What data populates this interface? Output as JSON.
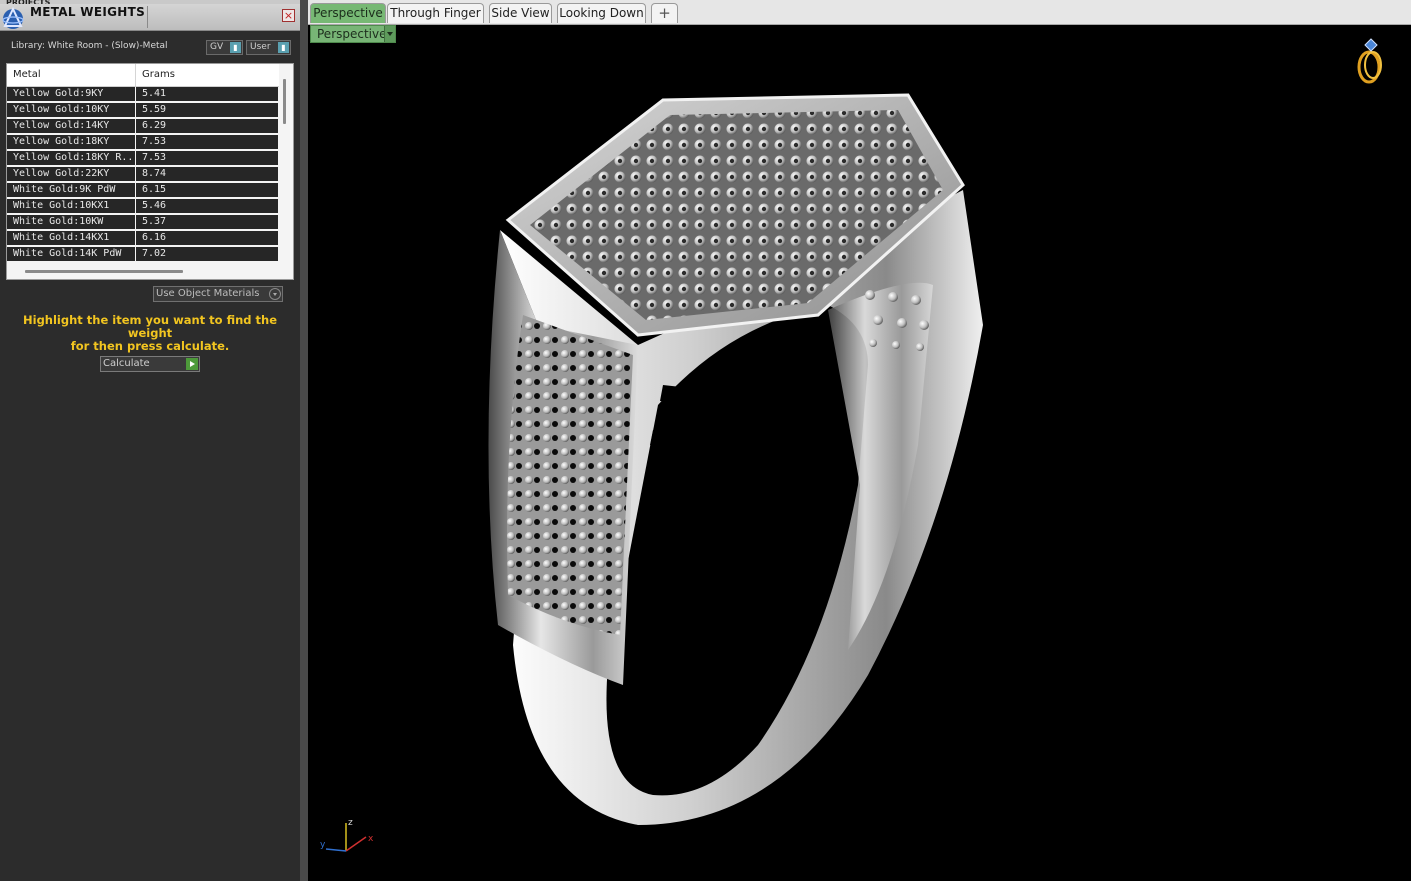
{
  "panel": {
    "header_strip": "PROJECTS",
    "title": "METAL WEIGHTS",
    "close_glyph": "×",
    "library_label": "Library: White Room - (Slow)-Metal",
    "gv_combo": "GV",
    "user_combo": "User",
    "table": {
      "columns": [
        "Metal",
        "Grams"
      ],
      "rows": [
        {
          "metal": "Yellow Gold:9KY",
          "grams": "5.41"
        },
        {
          "metal": "Yellow Gold:10KY",
          "grams": "5.59"
        },
        {
          "metal": "Yellow Gold:14KY",
          "grams": "6.29"
        },
        {
          "metal": "Yellow Gold:18KY",
          "grams": "7.53"
        },
        {
          "metal": "Yellow Gold:18KY R...",
          "grams": "7.53"
        },
        {
          "metal": "Yellow Gold:22KY",
          "grams": "8.74"
        },
        {
          "metal": "White Gold:9K PdW",
          "grams": "6.15"
        },
        {
          "metal": "White Gold:10KX1",
          "grams": "5.46"
        },
        {
          "metal": "White Gold:10KW",
          "grams": "5.37"
        },
        {
          "metal": "White Gold:14KX1",
          "grams": "6.16"
        },
        {
          "metal": "White Gold:14K PdW",
          "grams": "7.02"
        }
      ]
    },
    "materials_combo": "Use Object Materials",
    "instructions_line1": "Highlight the item you want to find the weight",
    "instructions_line2": "for then press calculate.",
    "calculate_label": "Calculate"
  },
  "viewport": {
    "tabs": [
      {
        "label": "Perspective",
        "active": true
      },
      {
        "label": "Through Finger",
        "active": false
      },
      {
        "label": "Side View",
        "active": false
      },
      {
        "label": "Looking Down",
        "active": false
      }
    ],
    "add_tab_glyph": "+",
    "view_combo": "Perspective",
    "axis": {
      "x": "x",
      "y": "y",
      "z": "z"
    },
    "colors": {
      "active_tab": "#77b874",
      "accent_yellow": "#f2c520",
      "viewport_bg": "#000000"
    }
  }
}
